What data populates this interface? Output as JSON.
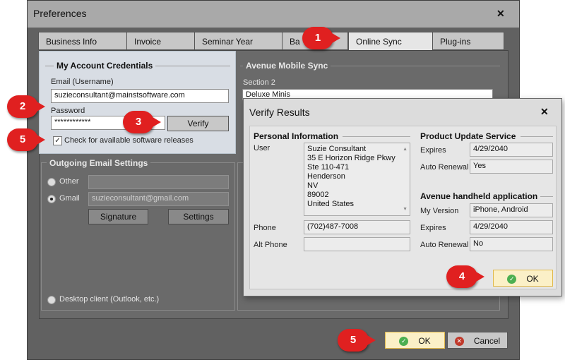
{
  "window": {
    "title": "Preferences",
    "close": "✕"
  },
  "tabs": [
    "Business Info",
    "Invoice",
    "Seminar Year",
    "Ba",
    "Online Sync",
    "Plug-ins"
  ],
  "credentials": {
    "title": "My Account Credentials",
    "email_label": "Email (Username)",
    "email_value": "suzieconsultant@mainstsoftware.com",
    "password_label": "Password",
    "password_value": "************",
    "verify_label": "Verify",
    "check_label": "Check for available software releases",
    "check_mark": "✓"
  },
  "mobile": {
    "title": "Avenue Mobile Sync",
    "section_label": "Section 2",
    "section_value": "Deluxe Minis"
  },
  "email_settings": {
    "title": "Outgoing Email Settings",
    "other_label": "Other",
    "gmail_label": "Gmail",
    "gmail_value": "suzieconsultant@gmail.com",
    "signature_label": "Signature",
    "settings_label": "Settings",
    "desktop_label": "Desktop client (Outlook, etc.)"
  },
  "footer": {
    "ok_label": "OK",
    "cancel_label": "Cancel"
  },
  "verify": {
    "title": "Verify Results",
    "close": "✕",
    "personal_title": "Personal Information",
    "user_label": "User",
    "user_lines": [
      "Suzie Consultant",
      "35 E Horizon Ridge Pkwy",
      "Ste 110-471",
      "Henderson",
      "NV",
      "89002",
      "United States"
    ],
    "phone_label": "Phone",
    "phone_value": "(702)487-7008",
    "alt_phone_label": "Alt Phone",
    "alt_phone_value": "",
    "pus_title": "Product Update Service",
    "expires_label": "Expires",
    "pus_expires": "4/29/2040",
    "auto_renewal_label": "Auto Renewal",
    "pus_auto_renewal": "Yes",
    "hh_title": "Avenue handheld application",
    "my_version_label": "My Version",
    "my_version_value": "iPhone, Android",
    "hh_expires_label": "Expires",
    "hh_expires": "4/29/2040",
    "hh_auto_renewal_label": "Auto Renewal",
    "hh_auto_renewal": "No",
    "ok_label": "OK"
  },
  "badges": [
    "1",
    "2",
    "3",
    "4",
    "5",
    "5"
  ],
  "colors": {
    "badge": "#e02020",
    "ok_button": "#fbf0c7",
    "ok_icon": "#4caf50",
    "cancel_icon": "#c0392b"
  }
}
